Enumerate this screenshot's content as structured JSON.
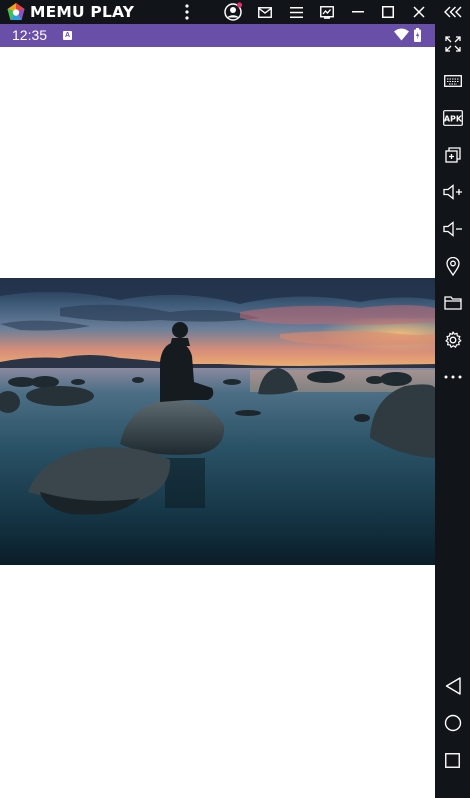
{
  "window": {
    "brand": "MEMU PLAY"
  },
  "titlebar_buttons": [
    {
      "name": "menu-kebab-icon"
    },
    {
      "name": "account-icon"
    },
    {
      "name": "mail-icon"
    },
    {
      "name": "hamburger-menu-icon"
    },
    {
      "name": "screen-cast-icon"
    },
    {
      "name": "minimize-icon"
    },
    {
      "name": "maximize-icon"
    },
    {
      "name": "close-icon"
    },
    {
      "name": "collapse-sidebar-icon"
    }
  ],
  "sidebar_buttons": [
    {
      "name": "fullscreen-icon"
    },
    {
      "name": "keyboard-mapping-icon"
    },
    {
      "name": "apk-install-icon",
      "label": "APK"
    },
    {
      "name": "multi-instance-icon"
    },
    {
      "name": "volume-up-icon"
    },
    {
      "name": "volume-down-icon"
    },
    {
      "name": "location-icon"
    },
    {
      "name": "shared-folder-icon"
    },
    {
      "name": "settings-icon"
    },
    {
      "name": "more-options-icon"
    },
    {
      "name": "back-nav-icon"
    },
    {
      "name": "home-nav-icon"
    },
    {
      "name": "recents-nav-icon"
    }
  ],
  "statusbar": {
    "time": "12:35",
    "notification_letter": "A"
  },
  "content": {
    "image_subject": "person-sitting-on-rock-at-sunset-lake"
  },
  "colors": {
    "statusbar": "#6a4fa8",
    "chrome": "#111418",
    "screen_bg": "#ffffff",
    "notification_dot": "#e0306a"
  }
}
